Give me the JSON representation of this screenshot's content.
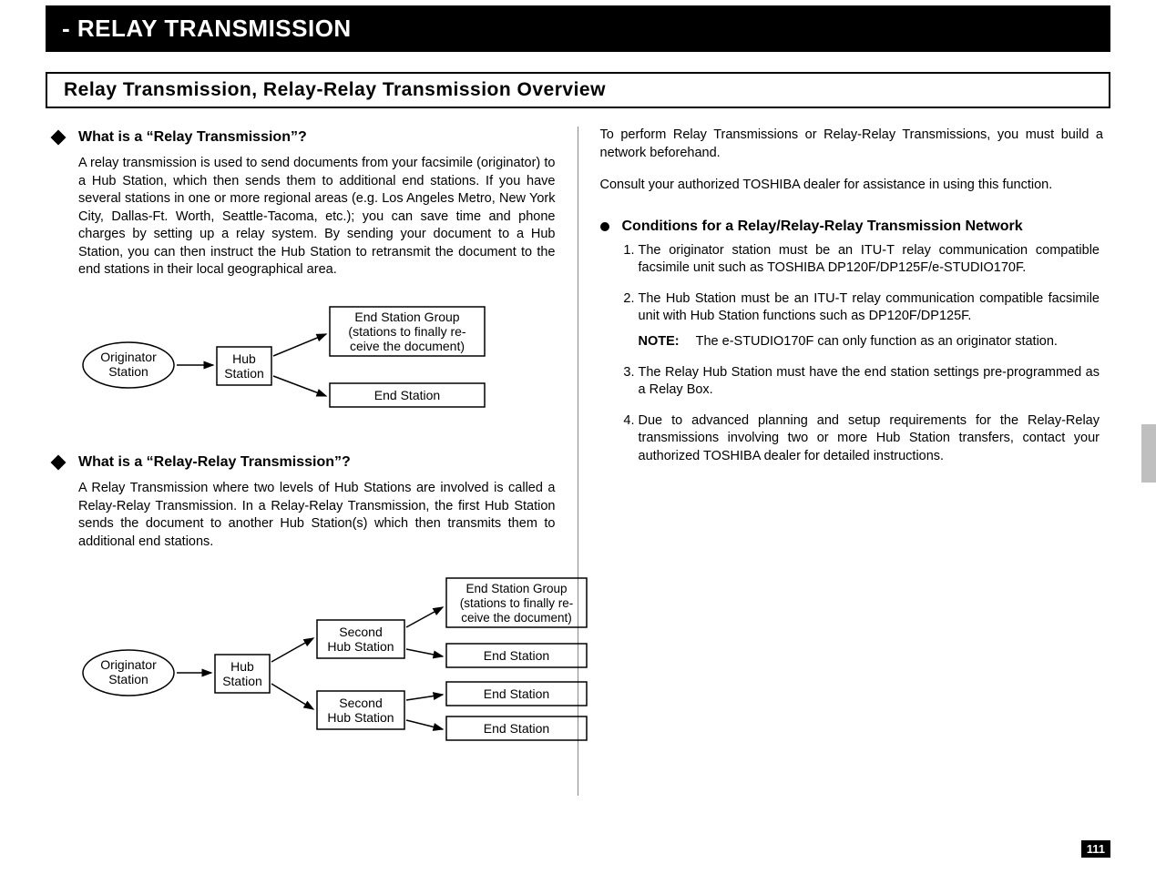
{
  "titleBar": "- RELAY TRANSMISSION",
  "subtitleBar": "Relay Transmission, Relay-Relay Transmission Overview",
  "left": {
    "sec1": {
      "title": "What is a “Relay Transmission”?",
      "body": "A relay transmission is used to send documents from your facsimile (originator) to a Hub Station, which then sends them to additional end stations. If you have several stations in one or more regional areas (e.g. Los Angeles Metro, New York City, Dallas-Ft. Worth, Seattle-Tacoma, etc.); you can save time and phone charges by setting up a relay system. By sending your document to a Hub Station, you can then instruct the Hub Station to retransmit the document to the end stations in their local geographical area."
    },
    "diagram1": {
      "originator_l1": "Originator",
      "originator_l2": "Station",
      "hub_l1": "Hub",
      "hub_l2": "Station",
      "endgroup_l1": "End Station Group",
      "endgroup_l2": "(stations to finally re-",
      "endgroup_l3": "ceive the document)",
      "endstation": "End Station"
    },
    "sec2": {
      "title": "What is a “Relay-Relay Transmission”?",
      "body": "A Relay Transmission where two levels of Hub Stations are involved is called a Relay-Relay Transmission. In a Relay-Relay Transmission, the first Hub Station sends the document to another Hub Station(s) which then transmits them to additional end stations."
    },
    "diagram2": {
      "originator_l1": "Originator",
      "originator_l2": "Station",
      "hub_l1": "Hub",
      "hub_l2": "Station",
      "second_l1": "Second",
      "second_l2": "Hub Station",
      "endgroup_l1": "End Station Group",
      "endgroup_l2": "(stations to finally re-",
      "endgroup_l3": "ceive the document)",
      "endstation": "End Station"
    }
  },
  "right": {
    "intro1": "To perform Relay Transmissions or Relay-Relay Transmissions, you must build a network beforehand.",
    "intro2": "Consult your authorized TOSHIBA dealer for assistance in using this function.",
    "condTitle": "Conditions for a Relay/Relay-Relay Transmission Network",
    "conds": {
      "c1": "The originator station must be an ITU-T relay communication compatible facsimile unit such as TOSHIBA DP120F/DP125F/e-STUDIO170F.",
      "c2": "The Hub Station must be an ITU-T relay communication compatible facsimile unit with Hub Station functions such as DP120F/DP125F.",
      "noteLabel": "NOTE:",
      "noteText": "The e-STUDIO170F can only function as an originator station.",
      "c3": "The Relay Hub Station must have the end station settings pre-programmed as a Relay Box.",
      "c4": "Due to advanced planning and setup requirements for the Relay-Relay transmissions involving two or more Hub Station transfers, contact your authorized TOSHIBA dealer for detailed instructions."
    }
  },
  "pageNumber": "111"
}
